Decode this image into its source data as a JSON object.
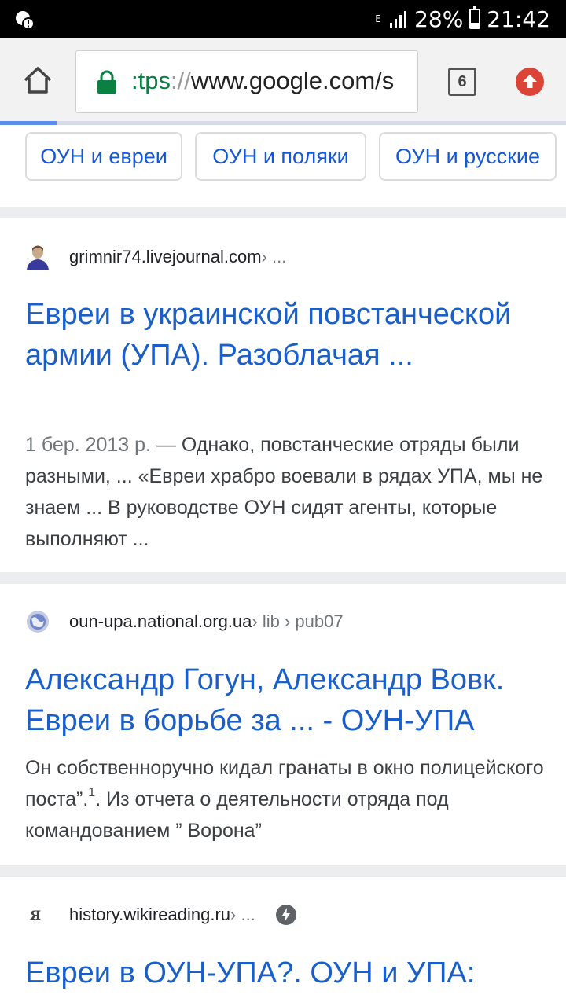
{
  "status_bar": {
    "battery_percent": "28%",
    "time": "21:42",
    "network_label": "E"
  },
  "browser": {
    "url_scheme": ":tps",
    "url_separator": "://",
    "url_host": "www.google.com/s",
    "tab_count": "6"
  },
  "chips": [
    "ОУН и евреи",
    "ОУН и поляки",
    "ОУН и русские"
  ],
  "results": [
    {
      "domain": "grimnir74.livejournal.com",
      "path": " › ...",
      "title": "Евреи в украинской повстанческой армии (УПА). Разоблачая ...",
      "date": "1 бер. 2013 р. — ",
      "snippet": "Однако, повстанческие отряды были разными, ... «Евреи храбро воевали в рядах УПА, мы не знаем ... В руководстве ОУН сидят агенты, которые выполняют ..."
    },
    {
      "domain": "oun-upa.national.org.ua",
      "path": " › lib › pub07",
      "title": "Александр Гогун, Александр Вовк. Евреи в борьбе за ... - ОУН-УПА",
      "snippet_a": "Он собственноручно кидал гранаты в окно полицейского поста”.",
      "snippet_sup": "1",
      "snippet_b": ". Из отчета о деятельности отряда под командованием ” Ворона”"
    },
    {
      "domain": "history.wikireading.ru",
      "path": " › ...",
      "title": "Евреи в ОУН-УПА?. ОУН и УПА:"
    }
  ]
}
